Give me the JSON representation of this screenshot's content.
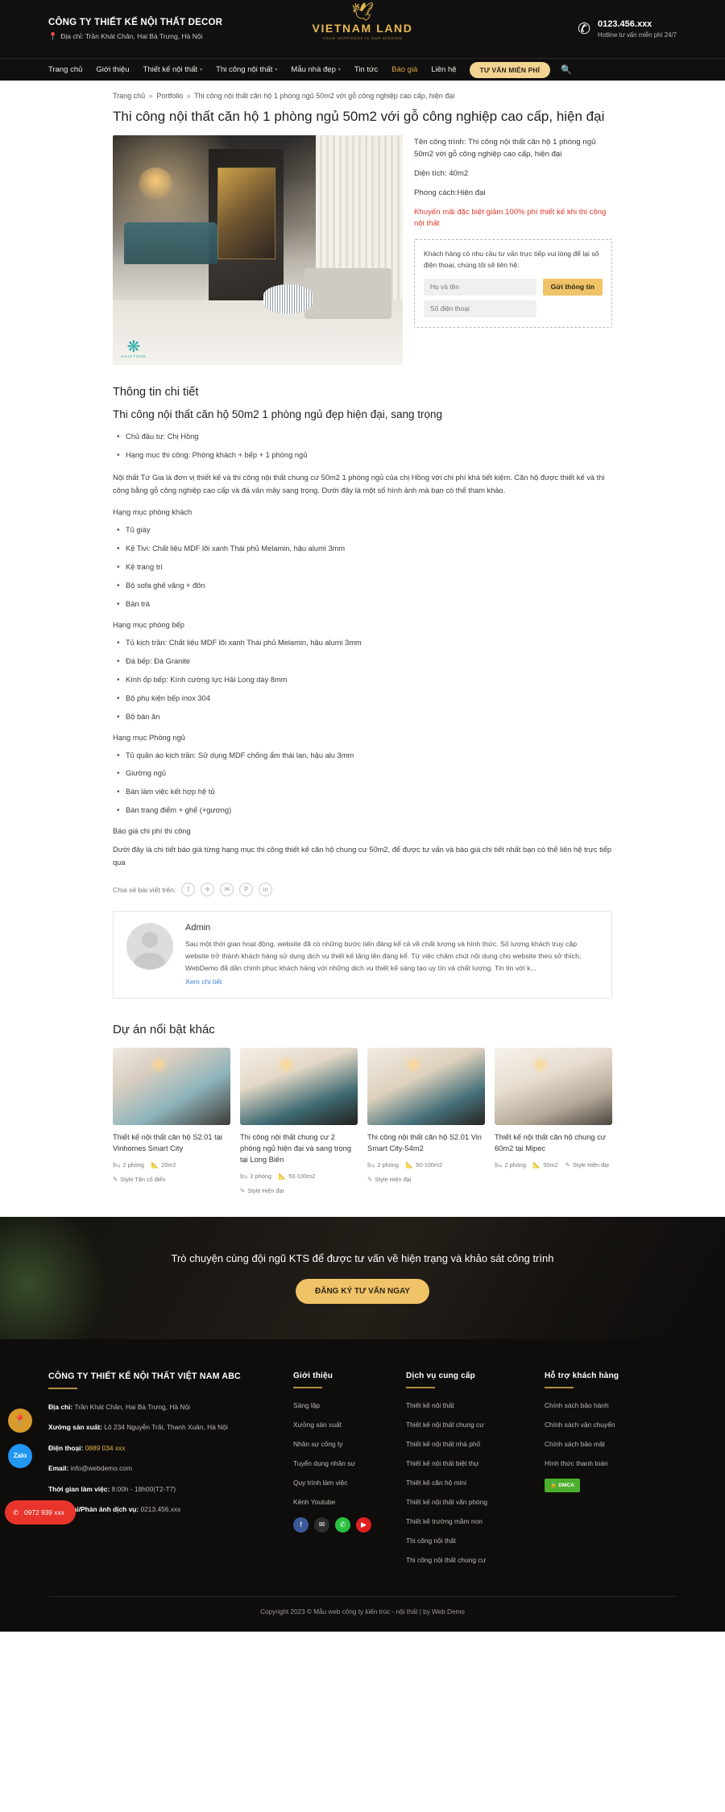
{
  "header": {
    "company": "CÔNG TY THIẾT KẾ NỘI THẤT DECOR",
    "address": "Địa chỉ: Trần Khát Chân, Hai Bà Trưng, Hà Nội",
    "logo_word": "VIETNAM LAND",
    "logo_tagline": "YOUR HAPPINESS IS OUR MISSION",
    "phone": "0123.456.xxx",
    "phone_note": "Hotline tư vấn miễn phí 24/7"
  },
  "nav": {
    "items": [
      {
        "label": "Trang chủ",
        "caret": false,
        "gold": false
      },
      {
        "label": "Giới thiệu",
        "caret": false,
        "gold": false
      },
      {
        "label": "Thiết kế nội thất",
        "caret": true,
        "gold": false
      },
      {
        "label": "Thi công nội thất",
        "caret": true,
        "gold": false
      },
      {
        "label": "Mẫu nhà đẹp",
        "caret": true,
        "gold": false
      },
      {
        "label": "Tin tức",
        "caret": false,
        "gold": false
      },
      {
        "label": "Báo giá",
        "caret": false,
        "gold": true
      },
      {
        "label": "Liên hệ",
        "caret": false,
        "gold": false
      }
    ],
    "cta": "TƯ VẤN MIỄN PHÍ",
    "search_icon": "search-icon"
  },
  "breadcrumb": {
    "items": [
      "Trang chủ",
      "Portfolio",
      "Thi công nội thất căn hộ 1 phòng ngủ 50m2 với gỗ công nghiệp cao cấp, hiện đại"
    ],
    "separator": "»"
  },
  "page_title": "Thi công nội thất căn hộ 1 phòng ngủ 50m2 với gỗ công nghiệp cao cấp, hiện đại",
  "hero": {
    "watermark_text": "UNISTONE",
    "meta": [
      "Tên công trình: Thi công nội thất căn hộ 1 phòng ngủ 50m2 với gỗ công nghiệp cao cấp, hiện đại",
      "Diện tích: 40m2",
      "Phong cách:Hiện đại"
    ],
    "promo": "Khuyến mãi đặc biệt giảm 100% phí thiết kế khi thi công nội thất",
    "lead_form": {
      "intro": "Khách hàng có nhu cầu tư vấn trực tiếp vui lòng để lại số điện thoại, chúng tôi sẽ liên hệ:",
      "name_placeholder": "Họ và tên",
      "phone_placeholder": "Số điện thoại",
      "submit_label": "Gửi thông tin"
    }
  },
  "article": {
    "heading": "Thông tin chi tiết",
    "subheading": "Thi công nội thất căn hộ 50m2 1 phòng ngủ đẹp hiện đại, sang trọng",
    "top_bullets": [
      "Chủ đầu tư: Chị Hồng",
      "Hạng mục thi công: Phòng khách + bếp + 1 phòng ngủ"
    ],
    "intro_paragraph": "Nội thất Tứ Gia là đơn vị thiết kế và thi công nội thất chung cư 50m2 1 phòng ngủ của chị Hồng với chi phí khá tiết kiệm. Căn hộ được thiết kế và thi công bằng gỗ công nghiệp cao cấp và đá vân mây sang trọng. Dưới đây là một số hình ảnh mà bạn có thể tham khảo.",
    "sections": [
      {
        "label": "Hạng mục phòng khách",
        "items": [
          "Tủ giày",
          "Kệ Tivi: Chất liệu MDF lõi xanh Thái phủ Melamin, hậu alumi 3mm",
          "Kệ trang trí",
          "Bộ sofa ghế văng + đôn",
          "Bàn trà"
        ]
      },
      {
        "label": "Hạng mục phòng bếp",
        "items": [
          "Tủ kịch trần: Chất liệu MDF lõi xanh Thái phủ Melamin, hậu alumi 3mm",
          "Đá bếp: Đá Granite",
          "Kính ốp bếp: Kính cường lực Hải Long dày 8mm",
          "Bộ phụ kiện bếp inox 304",
          "Bộ bàn ăn"
        ]
      },
      {
        "label": "Hạng mục Phòng ngủ",
        "items": [
          "Tủ quần áo kịch trần: Sử dụng MDF chống ẩm thái lan, hậu alu 3mm",
          "Giường ngủ",
          "Bàn làm việc kết hợp hệ tủ",
          "Bàn trang điểm + ghế (+gương)"
        ]
      }
    ],
    "quote_label": "Báo giá chi phí thi công",
    "quote_paragraph": "Dưới đây là chi tiết báo giá từng hạng mục thi công thiết kế căn hộ chung cư 50m2, để được tư vấn và báo giá chi tiết nhất bạn có thể liên hệ trực tiếp qua",
    "share_label": "Chia sẻ bài viết trên:",
    "share_icons": [
      "facebook-icon",
      "twitter-icon",
      "email-icon",
      "pinterest-icon",
      "linkedin-icon"
    ],
    "share_glyphs": [
      "f",
      "🐦",
      "✉",
      "P",
      "in"
    ]
  },
  "author": {
    "name": "Admin",
    "bio": "Sau một thời gian hoạt động, website đã có những bước tiến đáng kể cả về chất lượng và hình thức. Số lượng khách truy cập website trở thành khách hàng sử dụng dịch vụ thiết kế tăng lên đáng kể. Từ việc chăm chút nội dung cho website theo sở thích, WebDemo đã dần chinh phục khách hàng với những dịch vụ thiết kế sáng tạo uy tín và chất lượng. Tin tin với k...",
    "link_label": "Xem chi tiết"
  },
  "related": {
    "heading": "Dự án nổi bật khác",
    "cards": [
      {
        "title": "Thiết kế nội thất căn hộ S2.01 tại Vinhomes Smart City",
        "rooms": "2 phòng",
        "area": "20m2",
        "style": "Style Tân cổ điển"
      },
      {
        "title": "Thi công nội thất chung cư 2 phòng ngủ hiện đại và sang trọng tại Long Biên",
        "rooms": "2 phòng",
        "area": "50-100m2",
        "style": "Style Hiện đại"
      },
      {
        "title": "Thi công nội thất căn hộ S2.01 Vin Smart City-54m2",
        "rooms": "2 phòng",
        "area": "50-100m2",
        "style": "Style Hiện đại"
      },
      {
        "title": "Thiết kế nội thất căn hộ chung cư 60m2 tại Mipec",
        "rooms": "2 phòng",
        "area": "50m2",
        "style": "Style Hiện đại"
      }
    ]
  },
  "cta_band": {
    "text": "Trò chuyện cùng đội ngũ KTS để được tư vấn về hiện trạng và khảo sát công trình",
    "button": "ĐĂNG KÝ TƯ VẤN NGAY"
  },
  "footer": {
    "col1": {
      "heading": "CÔNG TY THIẾT KẾ NỘI THẤT VIỆT NAM ABC",
      "lines": [
        {
          "label": "Địa chỉ:",
          "value": " Trần Khát Chân, Hai Bà Trưng, Hà Nội",
          "gold": false
        },
        {
          "label": "Xưởng sản xuất:",
          "value": " Lô 234 Nguyễn Trãi, Thanh Xuân, Hà Nội",
          "gold": false
        },
        {
          "label": "Điện thoại:",
          "value": " 0889 034 xxx",
          "gold": true
        },
        {
          "label": "Email:",
          "value": " info@webdemo.com",
          "gold": false
        },
        {
          "label": "Thời gian làm việc:",
          "value": " 8:00h - 18h00(T2-T7)",
          "gold": false
        },
        {
          "label": "Khiếu nại/Phản ánh dịch vụ:",
          "value": " 0213.456.xxx",
          "gold": false
        }
      ]
    },
    "col2": {
      "heading": "Giới thiệu",
      "links": [
        "Sáng lập",
        "Xưởng sản xuất",
        "Nhân sự công ty",
        "Tuyển dụng nhân sự",
        "Quy trình làm việc",
        "Kênh Youtube"
      ],
      "socials": [
        {
          "name": "facebook-icon",
          "glyph": "f",
          "cls": "fb"
        },
        {
          "name": "mail-icon",
          "glyph": "✉",
          "cls": "ml"
        },
        {
          "name": "zalo-icon",
          "glyph": "✆",
          "cls": "zl"
        },
        {
          "name": "youtube-icon",
          "glyph": "▶",
          "cls": "yt"
        }
      ]
    },
    "col3": {
      "heading": "Dịch vụ cung cấp",
      "links": [
        "Thiết kế nội thất",
        "Thiết kế nội thất chung cư",
        "Thiết kế nội thất nhà phố",
        "Thiết kế nội thất biệt thự",
        "Thiết kế căn hộ mini",
        "Thiết kế nội thất văn phòng",
        "Thiết kế trường mầm non",
        "Thi công nội thất",
        "Thi công nội thất chung cư"
      ]
    },
    "col4": {
      "heading": "Hỗ trợ khách hàng",
      "links": [
        "Chính sách bảo hành",
        "Chính sách vận chuyển",
        "Chính sách bảo mật",
        "Hình thức thanh toán"
      ],
      "badge": "DMCA"
    },
    "copyright": "Copyright 2023 © Mẫu web công ty kiến trúc - nội thất | by Web Demo",
    "floating": {
      "location_icon": "map-pin-icon",
      "zalo_icon": "zalo-icon",
      "hotline": "0972 939 xxx"
    }
  }
}
